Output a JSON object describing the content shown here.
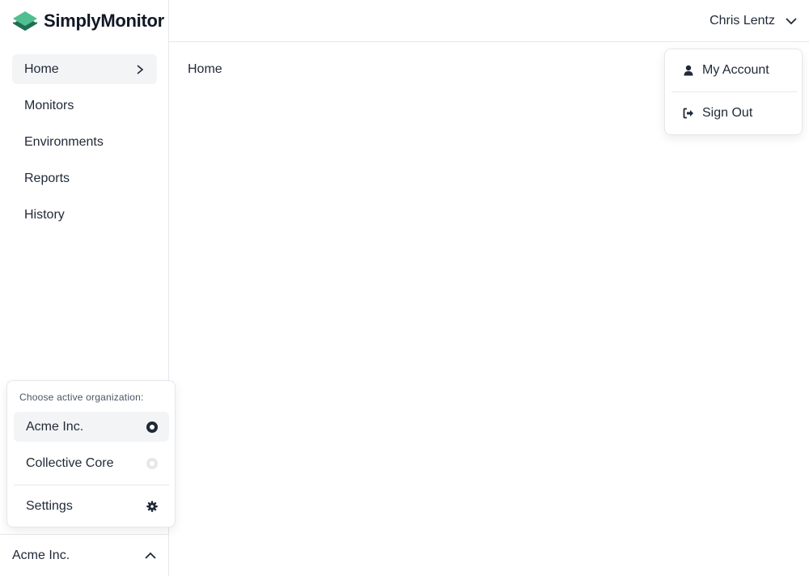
{
  "brand": {
    "name": "SimplyMonitor",
    "logo_icon": "layers-logo-icon"
  },
  "nav": {
    "items": [
      {
        "label": "Home",
        "active": true
      },
      {
        "label": "Monitors"
      },
      {
        "label": "Environments"
      },
      {
        "label": "Reports"
      },
      {
        "label": "History"
      }
    ]
  },
  "org_menu": {
    "title": "Choose active organization:",
    "options": [
      {
        "label": "Acme Inc.",
        "selected": true
      },
      {
        "label": "Collective Core",
        "selected": false
      }
    ],
    "settings_label": "Settings",
    "current": "Acme Inc."
  },
  "header": {
    "user_name": "Chris Lentz"
  },
  "user_menu": {
    "items": [
      {
        "label": "My Account",
        "icon": "user-icon"
      },
      {
        "label": "Sign Out",
        "icon": "sign-out-icon"
      }
    ]
  },
  "main": {
    "title": "Home"
  },
  "colors": {
    "brand_green_dark": "#1f6f54",
    "brand_green_light": "#4fbf8f",
    "text": "#1f2937",
    "border": "#e5e7eb"
  }
}
